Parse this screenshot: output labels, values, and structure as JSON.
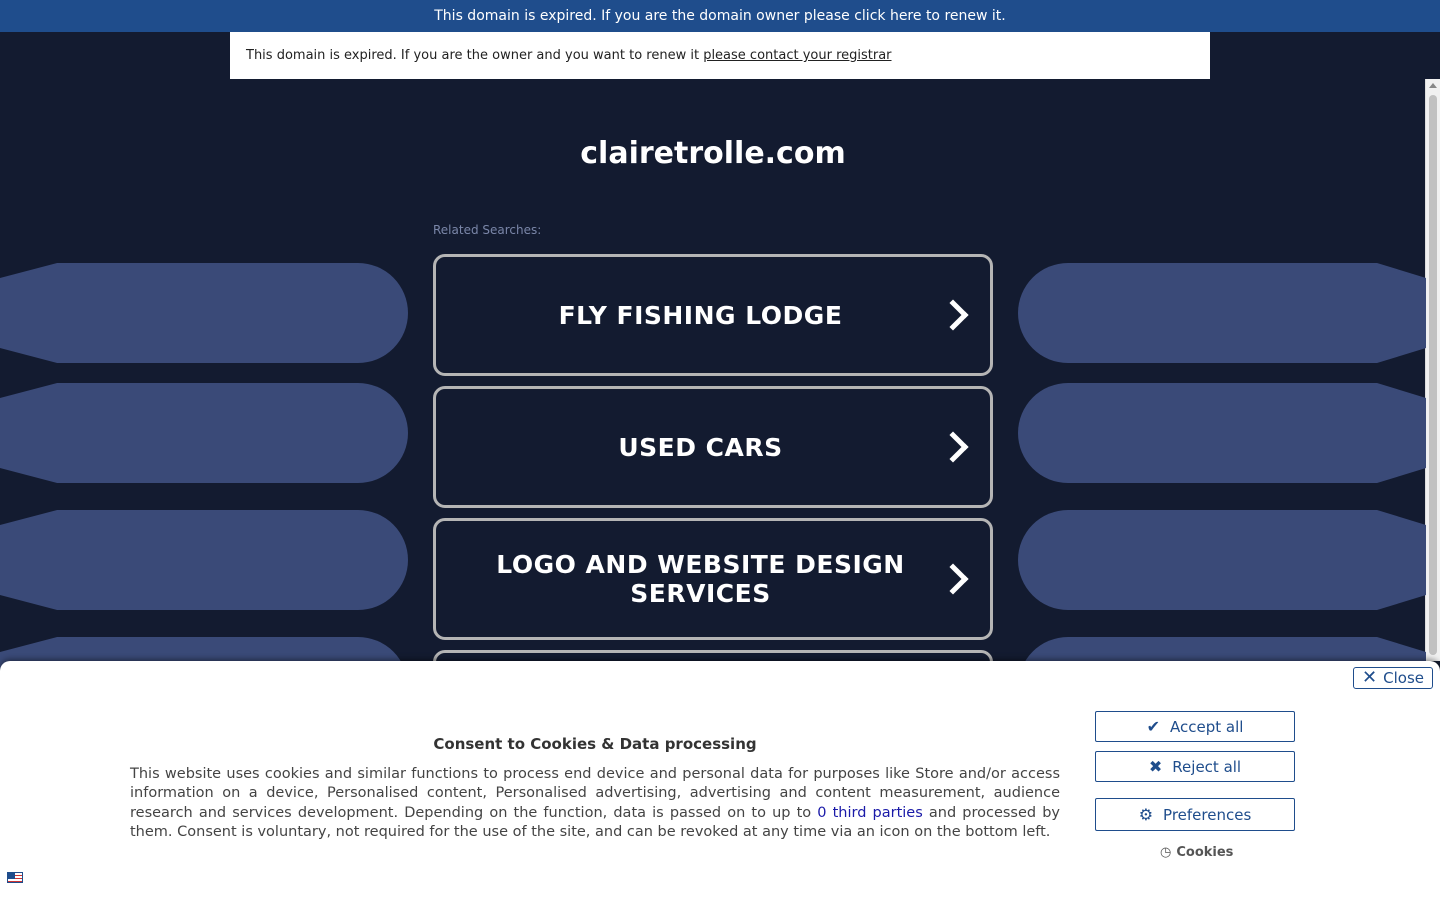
{
  "banner": {
    "text": "This domain is expired. If you are the domain owner please click here to renew it."
  },
  "notice": {
    "text": "This domain is expired. If you are the owner and you want to renew it ",
    "link": "please contact your registrar"
  },
  "page": {
    "domain": "clairetrolle.com",
    "related_label": "Related Searches:"
  },
  "searches": [
    {
      "label": "FLY FISHING LODGE"
    },
    {
      "label": "USED CARS"
    },
    {
      "label": "LOGO AND WEBSITE DESIGN SERVICES"
    }
  ],
  "cookie": {
    "close": "Close",
    "title": "Consent to Cookies & Data processing",
    "text_before": "This website uses cookies and similar functions to process end device and personal data for purposes like Store and/or access information on a device, Personalised content, Personalised advertising, advertising and content measurement, audience research and services development. Depending on the function, data is passed on to up to ",
    "text_link": "0 third parties",
    "text_after": " and processed by them. Consent is voluntary, not required for the use of the site, and can be revoked at any time via an icon on the bottom left.",
    "accept": "Accept all",
    "reject": "Reject all",
    "preferences": "Preferences",
    "cookies_link": "Cookies"
  }
}
